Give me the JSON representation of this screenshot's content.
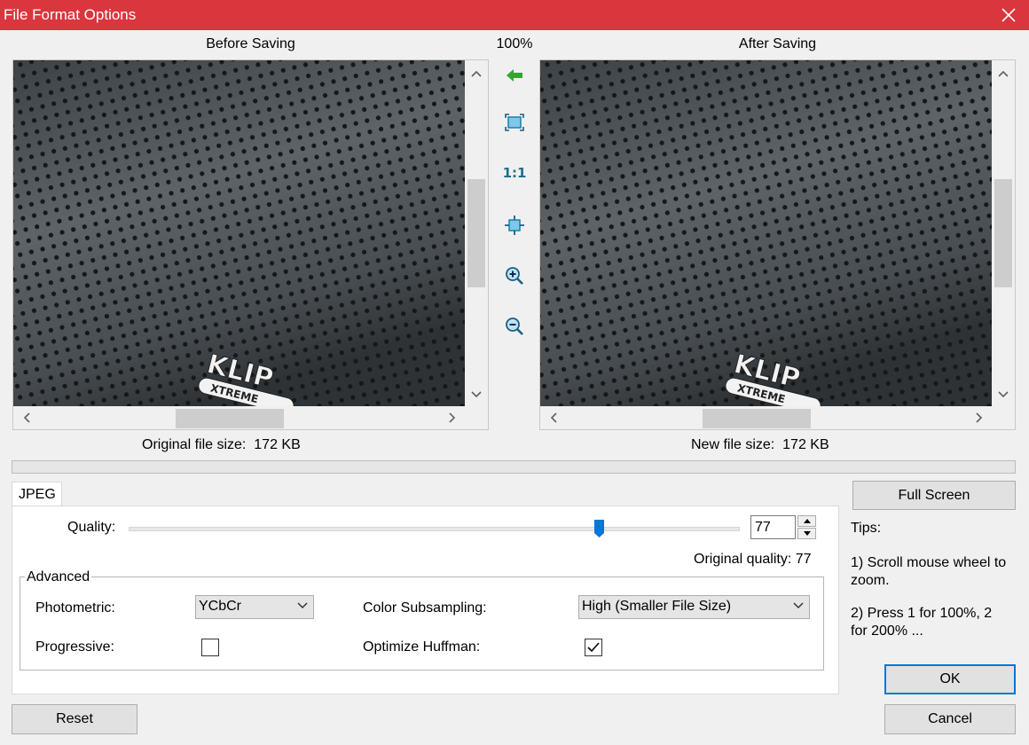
{
  "window": {
    "title": "File Format Options"
  },
  "viewers": {
    "before_label": "Before Saving",
    "after_label": "After Saving",
    "zoom": "100%",
    "original_size_label": "Original file size:",
    "original_size_value": "172 KB",
    "new_size_label": "New file size:",
    "new_size_value": "172 KB",
    "logo_text_top": "KLIP",
    "logo_text_bottom": "XTREME"
  },
  "toolbar": {
    "icons": [
      "back-arrow-icon",
      "fit-window-icon",
      "actual-size-icon",
      "center-icon",
      "zoom-in-icon",
      "zoom-out-icon"
    ],
    "actual_size_label": "1:1"
  },
  "tabs": [
    {
      "label": "JPEG"
    }
  ],
  "quality": {
    "label": "Quality:",
    "value": "77",
    "slider_fraction": 0.77,
    "original_quality_label": "Original quality: 77"
  },
  "advanced": {
    "legend": "Advanced",
    "photometric_label": "Photometric:",
    "photometric_value": "YCbCr",
    "subsampling_label": "Color Subsampling:",
    "subsampling_value": "High (Smaller File Size)",
    "progressive_label": "Progressive:",
    "progressive_checked": false,
    "huffman_label": "Optimize Huffman:",
    "huffman_checked": true
  },
  "side": {
    "full_screen": "Full Screen",
    "tips_title": "Tips:",
    "tip1_line1": "1) Scroll mouse wheel to",
    "tip1_line2": "zoom.",
    "tip2_line1": "2) Press 1 for 100%, 2",
    "tip2_line2": "for 200% ..."
  },
  "buttons": {
    "ok": "OK",
    "cancel": "Cancel",
    "reset": "Reset"
  },
  "colors": {
    "titlebar": "#d9363e",
    "accent": "#0078d7",
    "preview_bg": "#4a4f52"
  }
}
